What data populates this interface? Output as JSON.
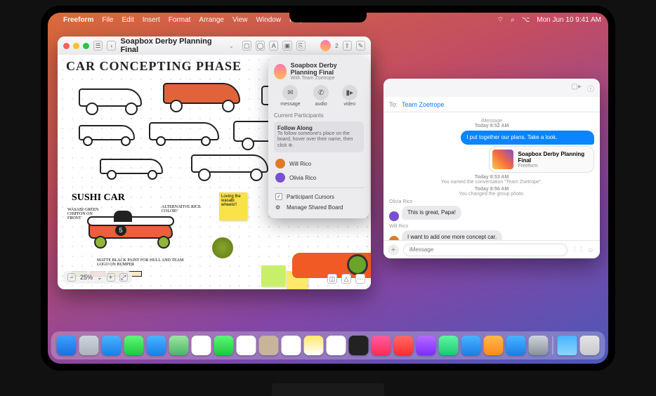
{
  "menubar": {
    "app": "Freeform",
    "items": [
      "File",
      "Edit",
      "Insert",
      "Format",
      "Arrange",
      "View",
      "Window",
      "Help"
    ],
    "clock": "Mon Jun 10  9:41 AM"
  },
  "freeform": {
    "title": "Soapbox Derby Planning Final",
    "heading": "CAR CONCEPTING PHASE",
    "sushi_label": "SUSHI CAR",
    "sticky1": "Loving the wasabi wheels!!",
    "note_wasabi": "WASABI GREEN CHIFFON ON FRONT",
    "note_alt": "ALTERNATIVE RICE COLOR?",
    "note_paint": "MATTE BLACK PAINT FOR HULL AND TEAM LOGO ON BUMPER",
    "car_number": "5",
    "zoom": {
      "minus": "−",
      "pct": "25%",
      "chev": "⌄",
      "plus": "+",
      "fit": "⤢"
    }
  },
  "popover": {
    "title": "Soapbox Derby Planning Final",
    "subtitle": "With Team Zoetrope",
    "actions": {
      "message": "message",
      "audio": "audio",
      "video": "video"
    },
    "section": "Current Participants",
    "follow_title": "Follow Along",
    "follow_desc": "To follow someone's place on the board, hover over their name, then click ⊕.",
    "p1": "Will Rico",
    "p2": "Olivia Rico",
    "cursors": "Participant Cursors",
    "manage": "Manage Shared Board"
  },
  "messages": {
    "to_label": "To:",
    "to_value": "Team Zoetrope",
    "meta1_time": "Today 8:52 AM",
    "meta1_sub": "iMessage",
    "out1": "I put together our plans. Take a look.",
    "attach_title": "Soapbox Derby Planning Final",
    "attach_sub": "Freeform",
    "meta2": "Today 8:53 AM",
    "meta2_sub": "You named the conversation \"Team Zoetrope\".",
    "meta3": "Today 8:56 AM",
    "meta3_sub": "You changed the group photo.",
    "from1": "Olivia Rico",
    "in1": "This is great, Papa!",
    "from2": "Will Rico",
    "in2": "I want to add one more concept car.",
    "compose_placeholder": "iMessage"
  },
  "colors": {
    "av1": "#e07a28",
    "av2": "#7a4fd0"
  }
}
